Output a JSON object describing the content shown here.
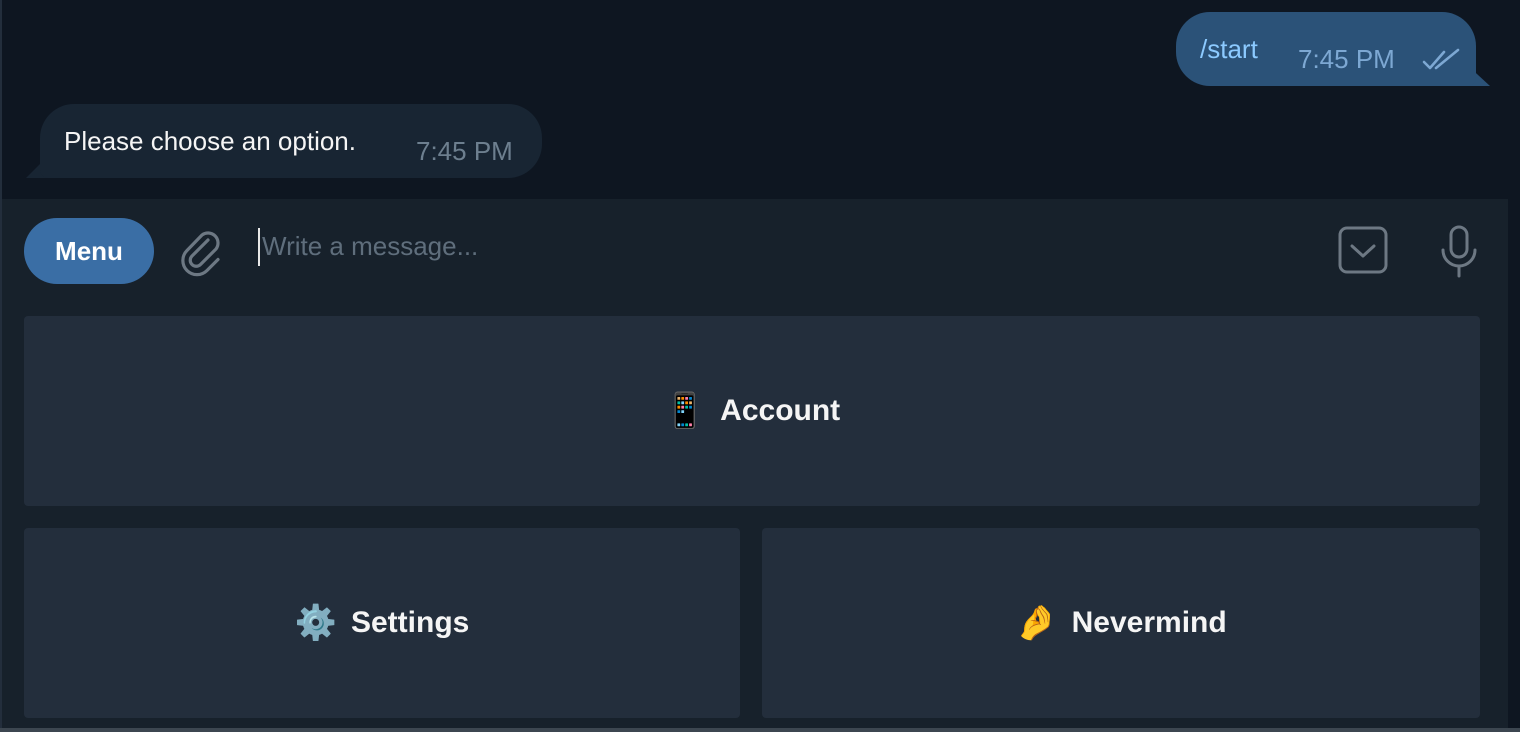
{
  "messages": {
    "outgoing": {
      "text": "/start",
      "time": "7:45 PM",
      "status_icon": "double-check-icon"
    },
    "incoming": {
      "text": "Please choose an option.",
      "time": "7:45 PM"
    }
  },
  "composer": {
    "menu_label": "Menu",
    "placeholder": "Write a message...",
    "value": "",
    "attach_icon": "paperclip-icon",
    "keyboard_icon": "bot-keyboard-icon",
    "mic_icon": "microphone-icon"
  },
  "keyboard": {
    "buttons": [
      {
        "emoji": "📱",
        "label": "Account"
      },
      {
        "emoji": "⚙️",
        "label": "Settings"
      },
      {
        "emoji": "🤌",
        "label": "Nevermind"
      }
    ]
  },
  "colors": {
    "chat_background": "#0e1621",
    "panel_background": "#17212b",
    "outgoing_bubble": "#2b5278",
    "incoming_bubble": "#182533",
    "accent": "#3a6ea5",
    "keyboard_button": "#232e3c"
  }
}
